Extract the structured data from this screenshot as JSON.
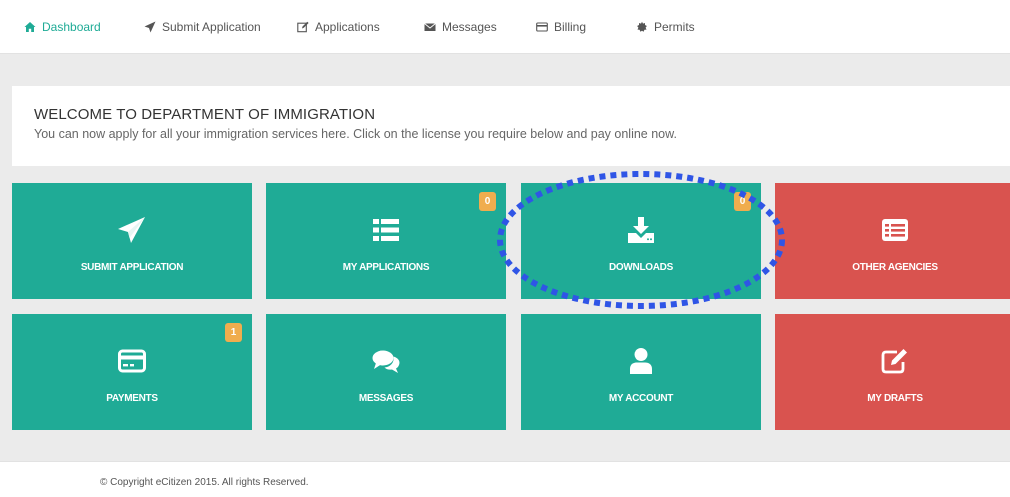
{
  "nav": {
    "items": [
      {
        "label": "Dashboard",
        "icon": "home-icon",
        "active": true
      },
      {
        "label": "Submit Application",
        "icon": "paper-plane-icon"
      },
      {
        "label": "Applications",
        "icon": "edit-icon"
      },
      {
        "label": "Messages",
        "icon": "envelope-icon"
      },
      {
        "label": "Billing",
        "icon": "credit-card-icon"
      },
      {
        "label": "Permits",
        "icon": "certificate-icon"
      }
    ]
  },
  "welcome": {
    "title": "WELCOME TO DEPARTMENT OF IMMIGRATION",
    "subtitle": "You can now apply for all your immigration services here. Click on the license you require below and pay online now."
  },
  "tiles": [
    {
      "label": "SUBMIT APPLICATION",
      "icon": "paper-plane-icon",
      "color": "#1fab96"
    },
    {
      "label": "MY APPLICATIONS",
      "icon": "list-icon",
      "color": "#1fab96",
      "badge": "0"
    },
    {
      "label": "DOWNLOADS",
      "icon": "download-icon",
      "color": "#1fab96",
      "badge": "0"
    },
    {
      "label": "OTHER AGENCIES",
      "icon": "list-alt-icon",
      "color": "#d9534f"
    },
    {
      "label": "PAYMENTS",
      "icon": "credit-card-icon",
      "color": "#1fab96",
      "badge": "1"
    },
    {
      "label": "MESSAGES",
      "icon": "comments-icon",
      "color": "#1fab96"
    },
    {
      "label": "MY ACCOUNT",
      "icon": "user-icon",
      "color": "#1fab96"
    },
    {
      "label": "MY DRAFTS",
      "icon": "edit-icon",
      "color": "#d9534f"
    }
  ],
  "colors": {
    "teal": "#1fab96",
    "red": "#d9534f",
    "badge": "#f0ad4e",
    "highlight": "#2f55e6"
  },
  "footer": {
    "copyright": "© Copyright eCitizen 2015. All rights Reserved."
  }
}
